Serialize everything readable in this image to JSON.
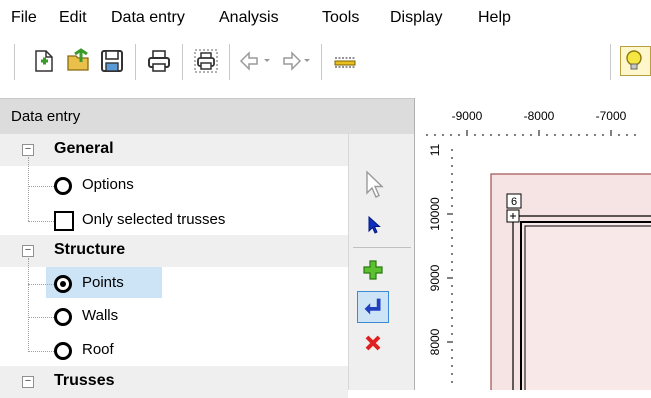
{
  "menu": [
    "File",
    "Edit",
    "Data entry",
    "Analysis",
    "Tools",
    "Display",
    "Help"
  ],
  "toolbar": {
    "icons": [
      "new-icon",
      "open-icon",
      "save-icon",
      "print-icon",
      "print-preview-icon",
      "undo-icon",
      "redo-icon",
      "measure-icon",
      "lightbulb-icon"
    ]
  },
  "panel": {
    "title": "Data entry",
    "categories": [
      {
        "label": "General",
        "toggle": "−",
        "items": [
          {
            "label": "Options",
            "control": "radio",
            "checked": false
          },
          {
            "label": "Only selected trusses",
            "control": "checkbox",
            "checked": false
          }
        ]
      },
      {
        "label": "Structure",
        "toggle": "−",
        "items": [
          {
            "label": "Points",
            "control": "radio",
            "checked": true,
            "selected": true
          },
          {
            "label": "Walls",
            "control": "radio",
            "checked": false
          },
          {
            "label": "Roof",
            "control": "radio",
            "checked": false
          }
        ]
      },
      {
        "label": "Trusses",
        "toggle": "−",
        "items": []
      }
    ]
  },
  "sidetools": [
    "pointer-icon",
    "select-arrow-icon",
    "add-icon",
    "enter-icon",
    "delete-icon"
  ],
  "drawing": {
    "x_ticks": [
      "-9000",
      "-8000",
      "-7000"
    ],
    "y_ticks": [
      "11",
      "10000",
      "9000",
      "8000"
    ],
    "element_number": "6",
    "colors": {
      "wall_fill": "#f6e3e3",
      "wall_stroke": "#a05050",
      "inner_fill": "#f8e8e8"
    }
  }
}
